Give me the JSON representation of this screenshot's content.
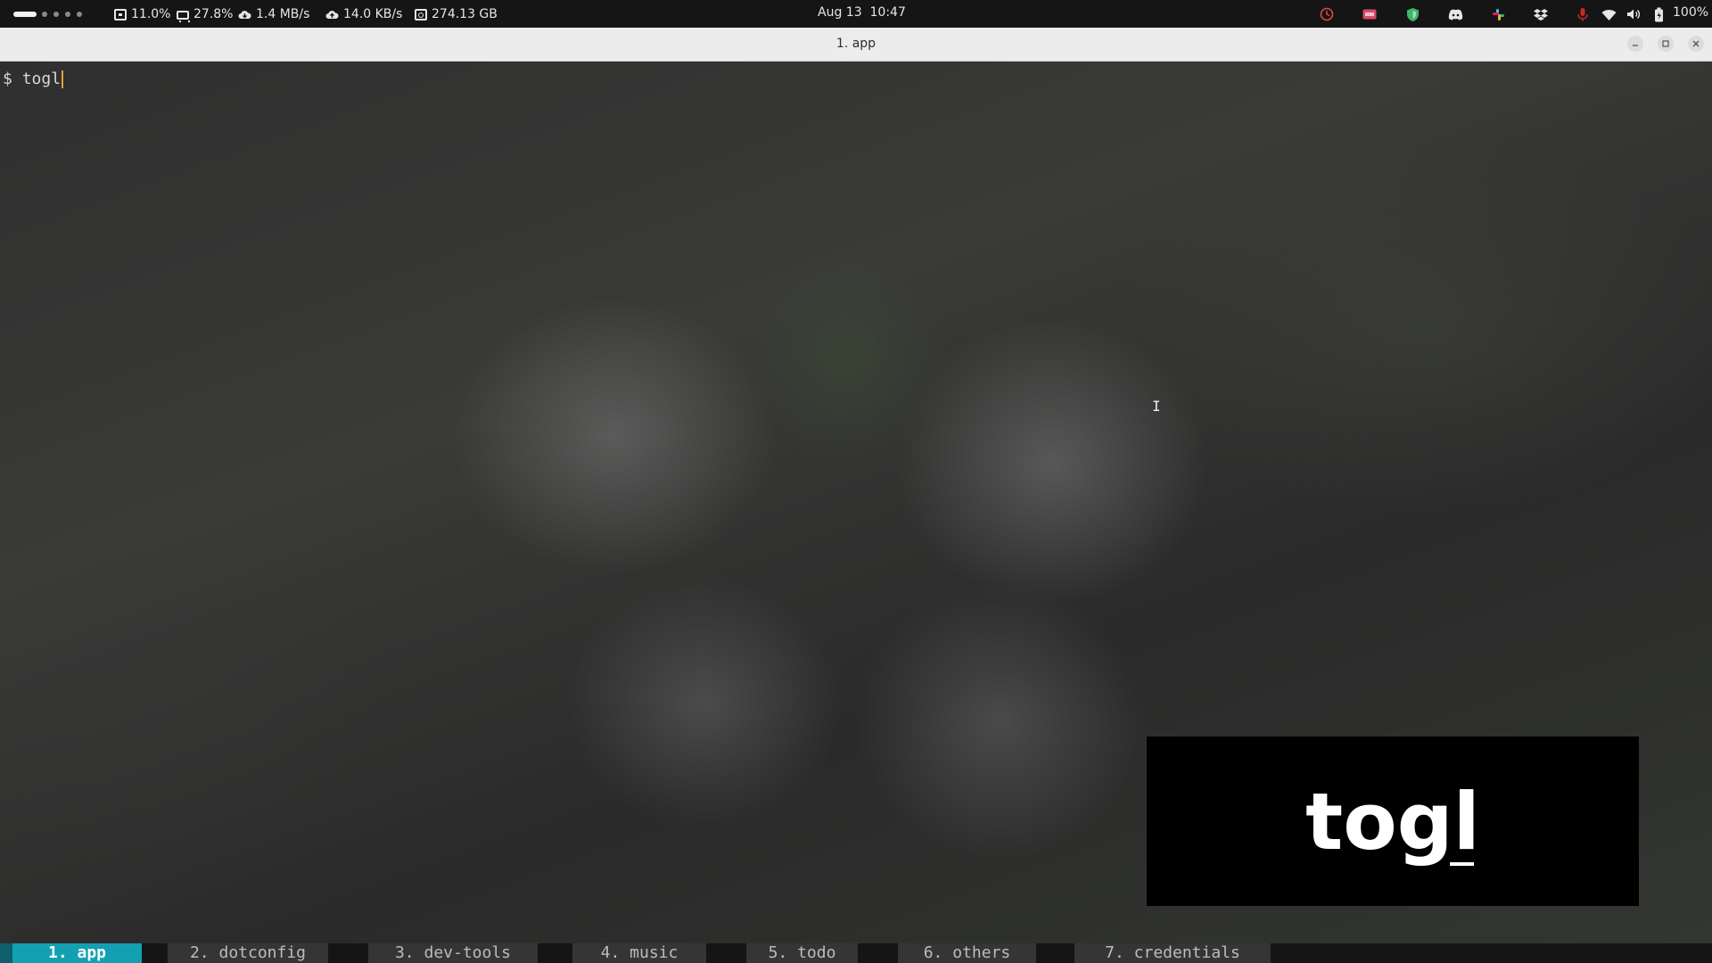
{
  "system_bar": {
    "cpu": "11.0%",
    "memory": "27.8%",
    "download_speed": "1.4 MB/s",
    "upload_speed": "14.0 KB/s",
    "disk": "274.13 GB",
    "date": "Aug 13",
    "time": "10:47",
    "battery": "100%",
    "tray_icons": [
      "timer-icon",
      "keyboard-layout-icon",
      "shield-vpn-icon",
      "discord-icon",
      "slack-icon",
      "dropbox-icon",
      "microphone-muted-icon",
      "wifi-icon",
      "volume-icon",
      "battery-icon"
    ]
  },
  "window": {
    "title": "1. app"
  },
  "terminal": {
    "prompt": "$",
    "command": "togl"
  },
  "key_overlay": {
    "text": "togl"
  },
  "tmux": {
    "windows": [
      {
        "label": "1. app",
        "active": true
      },
      {
        "label": "2. dotconfig",
        "active": false
      },
      {
        "label": "3. dev-tools",
        "active": false
      },
      {
        "label": "4. music",
        "active": false
      },
      {
        "label": "5. todo",
        "active": false
      },
      {
        "label": "6. others",
        "active": false
      },
      {
        "label": "7. credentials",
        "active": false
      }
    ]
  },
  "colors": {
    "accent": "#14a0b3",
    "cursor": "#e0a040",
    "panel": "#151515"
  }
}
